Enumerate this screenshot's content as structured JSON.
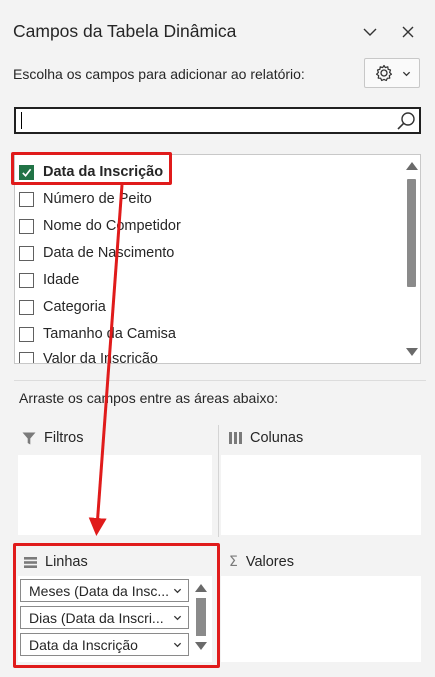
{
  "pane": {
    "title": "Campos da Tabela Dinâmica",
    "collapse_icon": "chevron-down-icon",
    "close_icon": "close-icon"
  },
  "chooser": {
    "label": "Escolha os campos para adicionar ao relatório:",
    "settings_icon": "gear-icon"
  },
  "search": {
    "value": "",
    "placeholder": "",
    "icon": "search-icon"
  },
  "fields": [
    {
      "label": "Data da Inscrição",
      "checked": true
    },
    {
      "label": "Número de Peito",
      "checked": false
    },
    {
      "label": "Nome do Competidor",
      "checked": false
    },
    {
      "label": "Data de Nascimento",
      "checked": false
    },
    {
      "label": "Idade",
      "checked": false
    },
    {
      "label": "Categoria",
      "checked": false
    },
    {
      "label": "Tamanho da Camisa",
      "checked": false
    },
    {
      "label": "Valor da Inscrição",
      "checked": false
    }
  ],
  "areas": {
    "instruction": "Arraste os campos entre as áreas abaixo:",
    "filters": {
      "label": "Filtros",
      "icon": "filter-icon"
    },
    "columns": {
      "label": "Colunas",
      "icon": "columns-icon"
    },
    "rows": {
      "label": "Linhas",
      "icon": "rows-icon",
      "items": [
        "Meses (Data da Insc...",
        "Dias (Data da Inscri...",
        "Data da Inscrição"
      ]
    },
    "values": {
      "label": "Valores",
      "icon": "sigma-icon"
    }
  },
  "colors": {
    "accent_green": "#217346",
    "highlight_red": "#e01b1b"
  }
}
